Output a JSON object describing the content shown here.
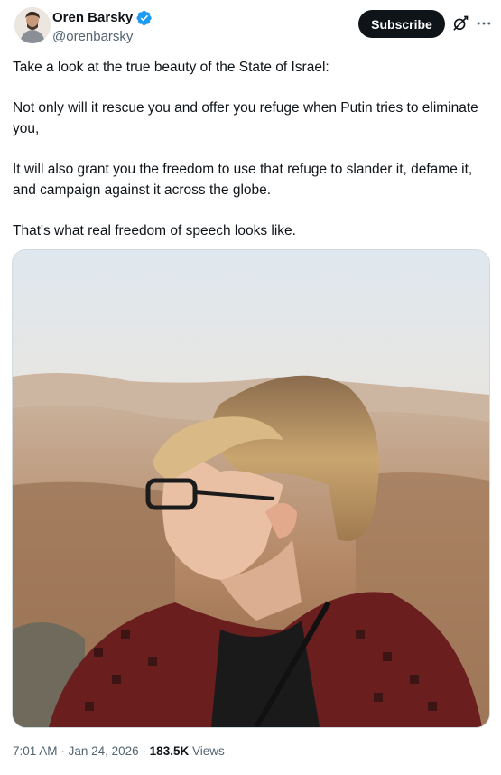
{
  "author": {
    "display_name": "Oren Barsky",
    "handle": "@orenbarsky",
    "verified": true,
    "verified_color": "#1d9bf0"
  },
  "actions": {
    "subscribe_label": "Subscribe",
    "grok_icon": "grok-icon",
    "more_icon": "more-icon"
  },
  "tweet": {
    "paragraphs": [
      "Take a look at the true beauty of the State of Israel:",
      "Not only will it rescue you and offer you refuge when Putin tries to eliminate you,",
      "It will also grant you the freedom to use that refuge to slander it, defame it, and campaign against it across the globe.",
      "That's what real freedom of speech looks like."
    ]
  },
  "meta": {
    "time": "7:01 AM",
    "separator": "·",
    "date": "Jan 24, 2026",
    "views_count": "183.5K",
    "views_label": "Views"
  },
  "colors": {
    "text_primary": "#0f1419",
    "text_secondary": "#536471",
    "button_bg": "#0f1419",
    "border": "#cfd9de"
  }
}
